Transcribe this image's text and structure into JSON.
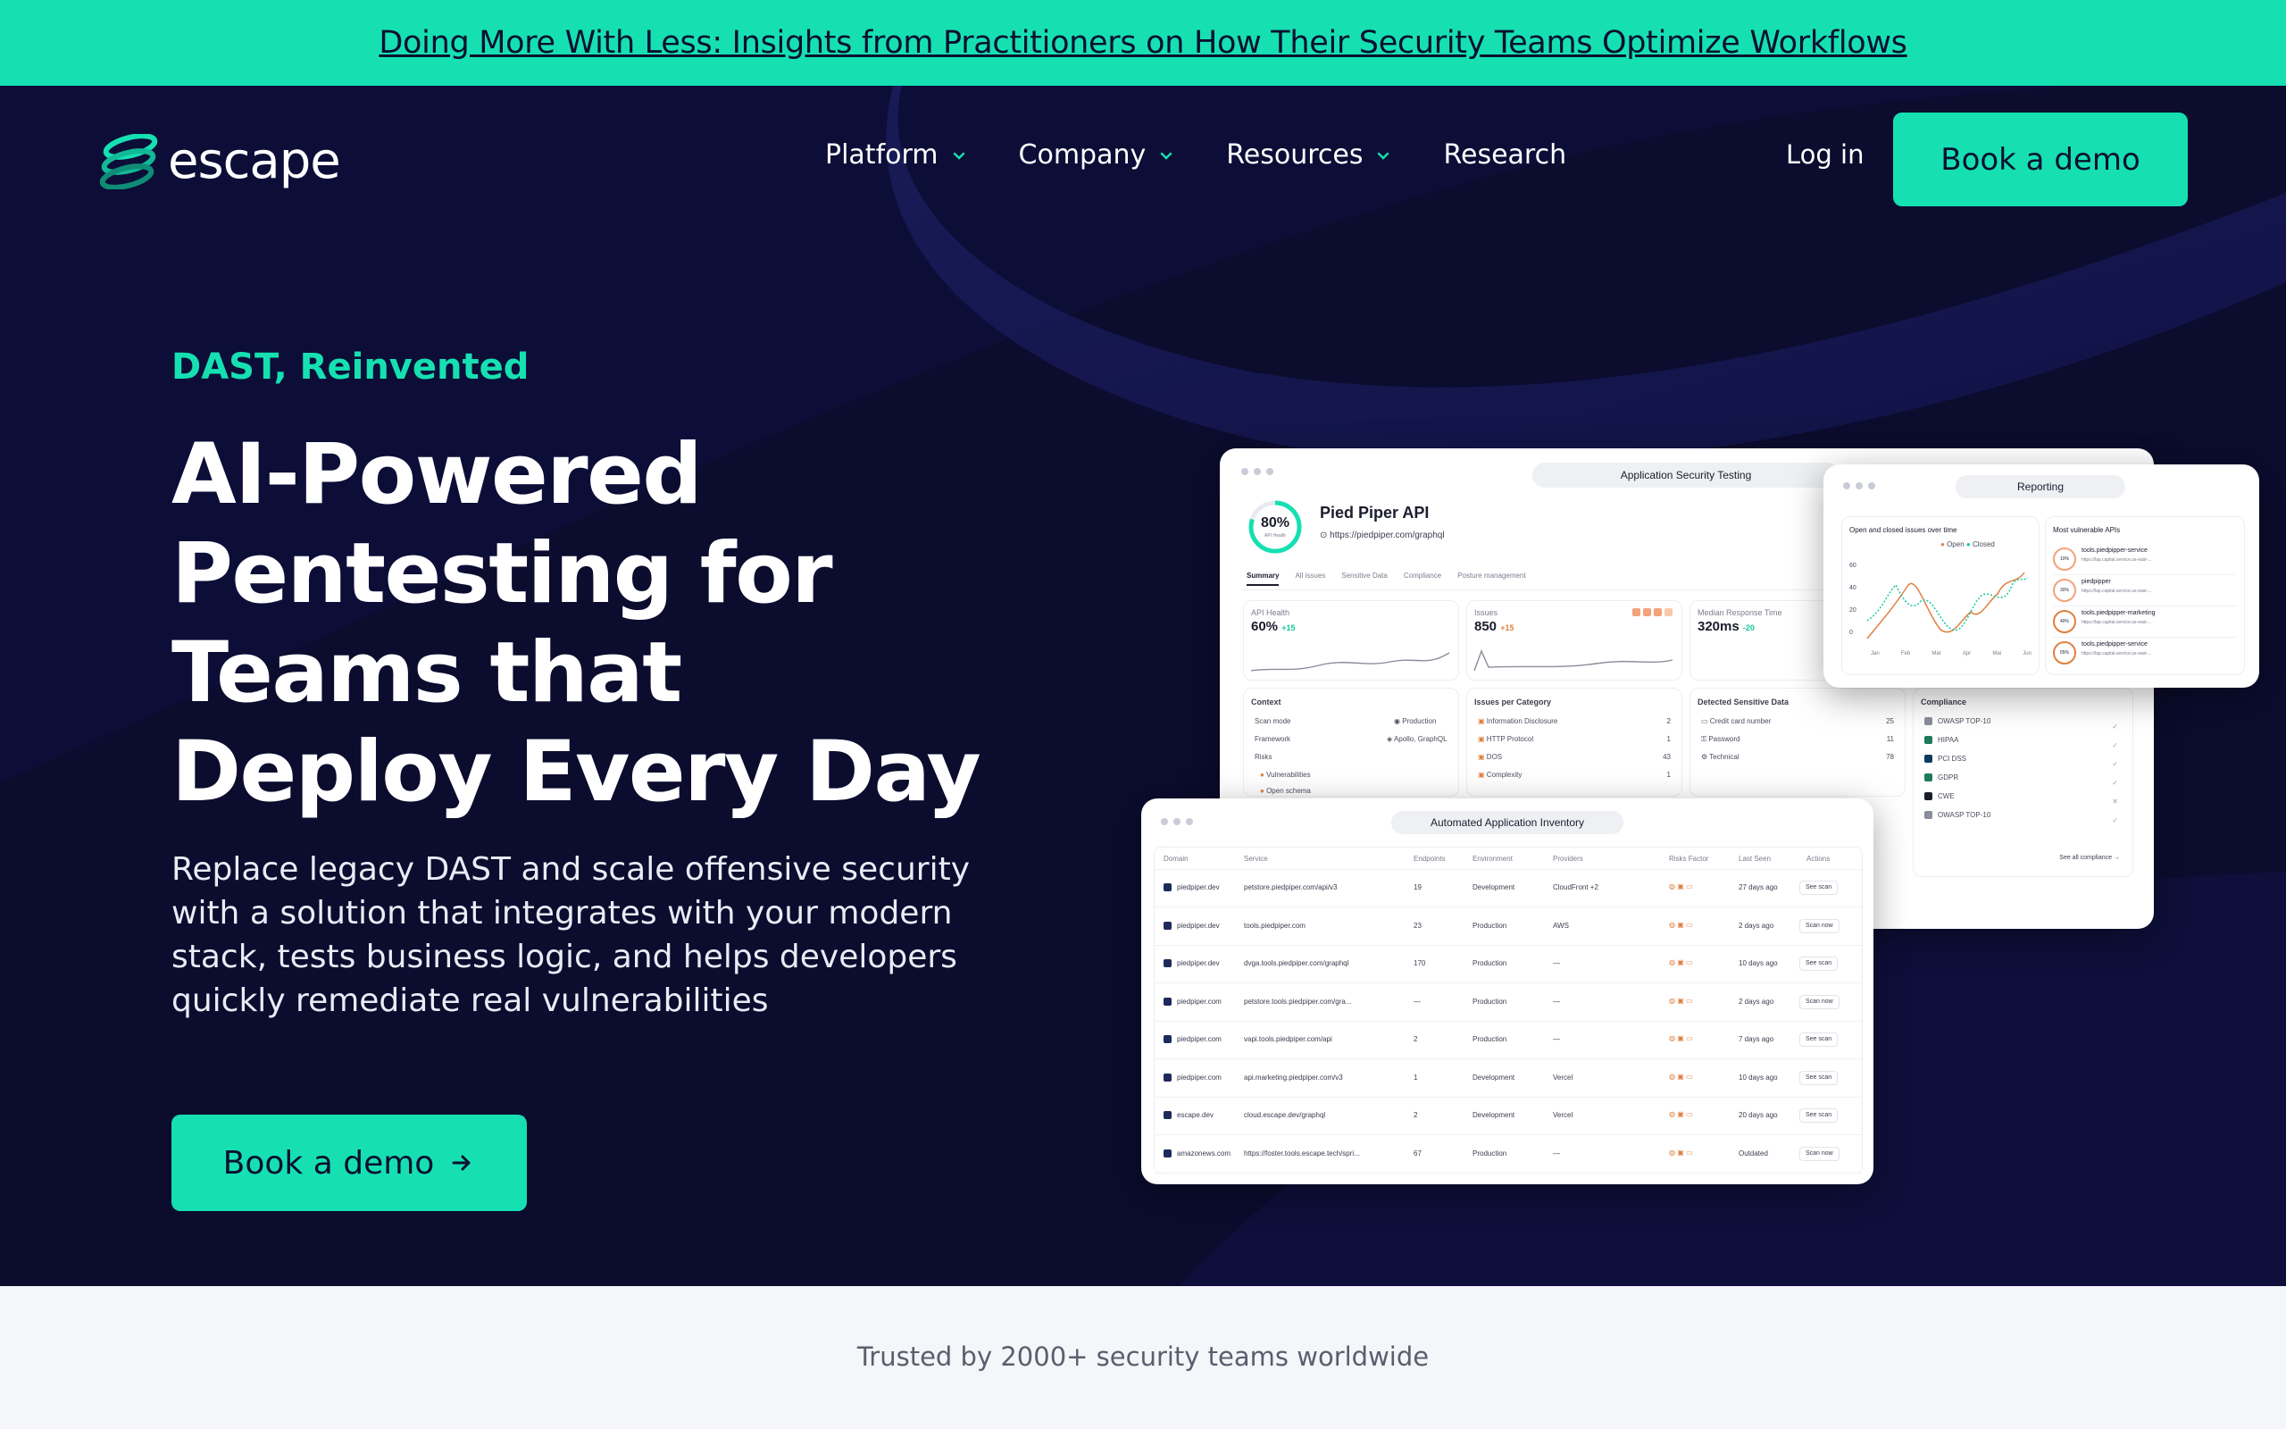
{
  "banner": {
    "text": "Doing More With Less: Insights from Practitioners on How Their Security Teams Optimize Workflows"
  },
  "nav": {
    "logo_text": "escape",
    "items": [
      {
        "label": "Platform",
        "has_dropdown": true
      },
      {
        "label": "Company",
        "has_dropdown": true
      },
      {
        "label": "Resources",
        "has_dropdown": true
      },
      {
        "label": "Research",
        "has_dropdown": false
      }
    ],
    "login": "Log in",
    "cta": "Book a demo"
  },
  "hero": {
    "eyebrow": "DAST, Reinvented",
    "headline": "AI-Powered Pentesting for Teams that Deploy Every Day",
    "subtitle": "Replace legacy DAST and scale offensive security with a solution that integrates with your modern stack, tests business logic, and helps developers quickly remediate real vulnerabilities",
    "cta": "Book a demo"
  },
  "trusted": "Trusted by 2000+ security teams worldwide",
  "colors": {
    "accent": "#16e0b2",
    "navy": "#0b0c2e"
  },
  "dashboard": {
    "main": {
      "title": "Application Security Testing",
      "api_name": "Pied Piper API",
      "api_url": "https://piedpiper.com/graphql",
      "score": "80%",
      "score_label": "API Health",
      "tabs": [
        "Summary",
        "All issues",
        "Sensitive Data",
        "Compliance",
        "Posture management"
      ],
      "metrics": [
        {
          "label": "API Health",
          "value": "60%",
          "delta": "+15"
        },
        {
          "label": "Issues",
          "value": "850",
          "delta": "+15"
        },
        {
          "label": "Median Response Time",
          "value": "320ms",
          "delta": "-20"
        }
      ],
      "context": {
        "title": "Context",
        "rows": [
          {
            "label": "Scan mode",
            "value": "Production"
          },
          {
            "label": "Framework",
            "value": "Apollo, GraphQL"
          },
          {
            "label": "Risks",
            "value": ""
          },
          {
            "label": "Vulnerabilities",
            "value": ""
          },
          {
            "label": "Open schema",
            "value": ""
          }
        ]
      },
      "issues_per_category": {
        "title": "Issues per Category",
        "rows": [
          {
            "label": "Information Disclosure",
            "value": "2"
          },
          {
            "label": "HTTP Protocol",
            "value": "1"
          },
          {
            "label": "DOS",
            "value": "43"
          },
          {
            "label": "Complexity",
            "value": "1"
          }
        ]
      },
      "sensitive_data": {
        "title": "Detected Sensitive Data",
        "rows": [
          {
            "label": "Credit card number",
            "value": "25"
          },
          {
            "label": "Password",
            "value": "11"
          },
          {
            "label": "Technical",
            "value": "78"
          }
        ]
      },
      "compliance": {
        "title": "Compliance",
        "rows": [
          "OWASP TOP-10",
          "HIPAA",
          "PCI DSS",
          "GDPR",
          "CWE",
          "OWASP TOP-10"
        ],
        "link": "See all compliance"
      }
    },
    "reporting": {
      "title": "Reporting",
      "chart_title": "Open and closed issues over time",
      "legend": [
        "Open",
        "Closed"
      ],
      "months": [
        "Jan",
        "Feb",
        "Mar",
        "Apr",
        "Mai",
        "Jun"
      ],
      "yticks": [
        "60",
        "40",
        "20",
        "0"
      ],
      "vuln_title": "Most vulnerable APIs",
      "vuln_apis": [
        {
          "name": "tools.piedpipper-service",
          "url": "https://lap.capital.service.us-east-...",
          "score": "10%"
        },
        {
          "name": "piedpipper",
          "url": "https://lap.capital.service.us-east-...",
          "score": "30%"
        },
        {
          "name": "tools.piedpipper-marketing",
          "url": "https://lap.capital.service.us-east-...",
          "score": "40%"
        },
        {
          "name": "tools.piedpipper-service",
          "url": "https://lap.capital.service.us-east-...",
          "score": "55%"
        }
      ]
    },
    "inventory": {
      "title": "Automated Application Inventory",
      "columns": [
        "Domain",
        "Service",
        "Endpoints",
        "Environment",
        "Providers",
        "Risks Factor",
        "Last Seen",
        "Actions"
      ],
      "rows": [
        {
          "domain": "piedpiper.dev",
          "service": "petstore.piedpiper.com/api/v3",
          "endpoints": "19",
          "environment": "Development",
          "provider": "CloudFront +2",
          "last_seen": "27 days ago",
          "action": "See scan"
        },
        {
          "domain": "piedpiper.dev",
          "service": "tools.piedpiper.com",
          "endpoints": "23",
          "environment": "Production",
          "provider": "AWS",
          "last_seen": "2 days ago",
          "action": "Scan now"
        },
        {
          "domain": "piedpiper.dev",
          "service": "dvga.tools.piedpiper.com/graphql",
          "endpoints": "170",
          "environment": "Production",
          "provider": "—",
          "last_seen": "10 days ago",
          "action": "See scan"
        },
        {
          "domain": "piedpiper.com",
          "service": "petstore.tools.piedpiper.com/gra...",
          "endpoints": "—",
          "environment": "Production",
          "provider": "—",
          "last_seen": "2 days ago",
          "action": "Scan now"
        },
        {
          "domain": "piedpiper.com",
          "service": "vapi.tools.piedpiper.com/api",
          "endpoints": "2",
          "environment": "Production",
          "provider": "—",
          "last_seen": "7 days ago",
          "action": "See scan"
        },
        {
          "domain": "piedpiper.com",
          "service": "api.marketing.piedpiper.com/v3",
          "endpoints": "1",
          "environment": "Development",
          "provider": "Vercel",
          "last_seen": "10 days ago",
          "action": "See scan"
        },
        {
          "domain": "escape.dev",
          "service": "cloud.escape.dev/graphql",
          "endpoints": "2",
          "environment": "Development",
          "provider": "Vercel",
          "last_seen": "20 days ago",
          "action": "See scan"
        },
        {
          "domain": "amazonews.com",
          "service": "https://foster.tools.escape.tech/spri...",
          "endpoints": "67",
          "environment": "Production",
          "provider": "—",
          "last_seen": "Outdated",
          "action": "Scan now"
        }
      ]
    }
  }
}
